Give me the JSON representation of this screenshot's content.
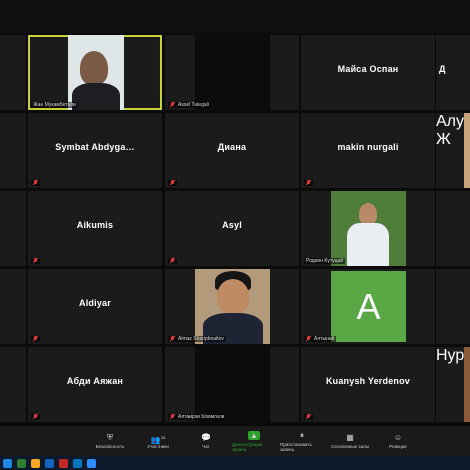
{
  "participants": [
    {
      "id": "zhan",
      "label": "",
      "footer": "Жан Мукамбетали",
      "active": true
    },
    {
      "id": "assel",
      "label": "",
      "footer": "Assel Tulegali"
    },
    {
      "id": "maysa",
      "label": "Майса Оспан",
      "footer": ""
    },
    {
      "id": "symbat",
      "label": "Symbat Abdyga…",
      "footer": ""
    },
    {
      "id": "diana",
      "label": "Диана",
      "footer": ""
    },
    {
      "id": "makin",
      "label": "makin nurgali",
      "footer": ""
    },
    {
      "id": "aikumis",
      "label": "Aikumis",
      "footer": ""
    },
    {
      "id": "asyl",
      "label": "Asyl",
      "footer": ""
    },
    {
      "id": "rodion",
      "label": "",
      "footer": "Родион Күтуцай"
    },
    {
      "id": "aldiyar",
      "label": "Aldiyar",
      "footer": ""
    },
    {
      "id": "almaz",
      "label": "",
      "footer": "Almaz Sharipbnaitov"
    },
    {
      "id": "a-avatar",
      "label": "A",
      "footer": "Алтынай"
    },
    {
      "id": "abdi",
      "label": "Абди Аяжан",
      "footer": ""
    },
    {
      "id": "altair",
      "label": "",
      "footer": "Алтаирзи Ызимгали"
    },
    {
      "id": "kuanysh",
      "label": "Kuanysh Yerdenov",
      "footer": ""
    }
  ],
  "edge": {
    "right_row1_label": "Д",
    "right_row2_footer": "Алуа Ж",
    "right_row5_footer": "Нурж"
  },
  "toolbar": {
    "items": [
      {
        "label": "Безопасность",
        "icon": "shield-icon"
      },
      {
        "label": "Участники",
        "icon": "participants-icon",
        "count": "28"
      },
      {
        "label": "Чат",
        "icon": "chat-icon"
      },
      {
        "label": "Демонстрация экрана",
        "icon": "share-screen-icon"
      },
      {
        "label": "Приостановить запись",
        "icon": "pause-record-icon"
      },
      {
        "label": "Сессионные залы",
        "icon": "breakout-icon"
      },
      {
        "label": "Реакции",
        "icon": "reactions-icon"
      }
    ]
  },
  "colors": {
    "active_border": "#c7d23a",
    "avatar_bg": "#5aa845",
    "share_green": "#2aa32a",
    "mic_muted": "#e03c3c"
  }
}
